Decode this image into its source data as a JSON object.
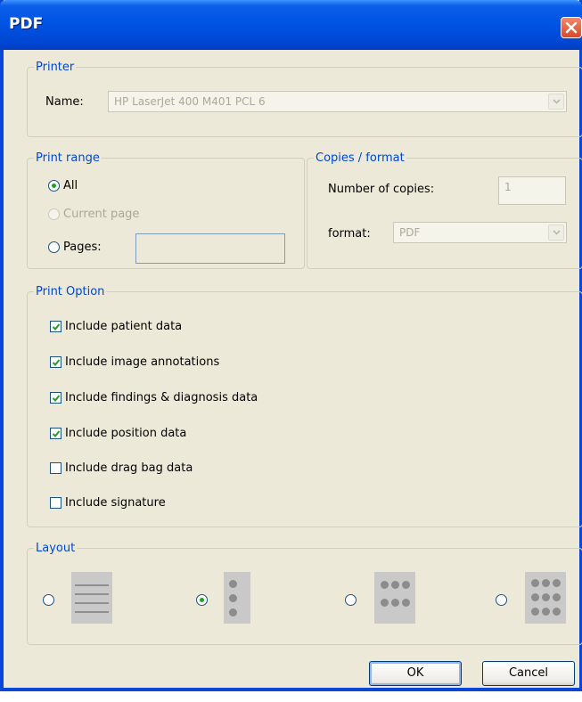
{
  "window": {
    "title": "PDF"
  },
  "printer": {
    "legend": "Printer",
    "name_label": "Name:",
    "printer_value": "HP LaserJet 400 M401 PCL 6"
  },
  "print_range": {
    "legend": "Print range",
    "all_label": "All",
    "current_page_label": "Current page",
    "pages_label": "Pages:",
    "selected": "All",
    "pages_value": ""
  },
  "copies_format": {
    "legend": "Copies / format",
    "copies_label": "Number of copies:",
    "copies_value": "1",
    "format_label": "format:",
    "format_value": "PDF"
  },
  "print_option": {
    "legend": "Print Option",
    "options": [
      {
        "label": "Include patient data",
        "checked": true
      },
      {
        "label": "Include image annotations",
        "checked": true
      },
      {
        "label": "Include findings & diagnosis data",
        "checked": true
      },
      {
        "label": "Include position data",
        "checked": true
      },
      {
        "label": "Include drag bag data",
        "checked": false
      },
      {
        "label": "Include signature",
        "checked": false
      }
    ]
  },
  "layout": {
    "legend": "Layout",
    "selected_index": 1,
    "options": [
      "lines-layout-icon",
      "single-column-dots-icon",
      "two-by-three-dots-icon",
      "three-by-three-dots-icon"
    ]
  },
  "buttons": {
    "ok": "OK",
    "cancel": "Cancel"
  },
  "colors": {
    "title_bar": "#0054e3",
    "legend_text": "#0046d5",
    "checkmark": "#21a121",
    "close_button": "#d8472a"
  }
}
